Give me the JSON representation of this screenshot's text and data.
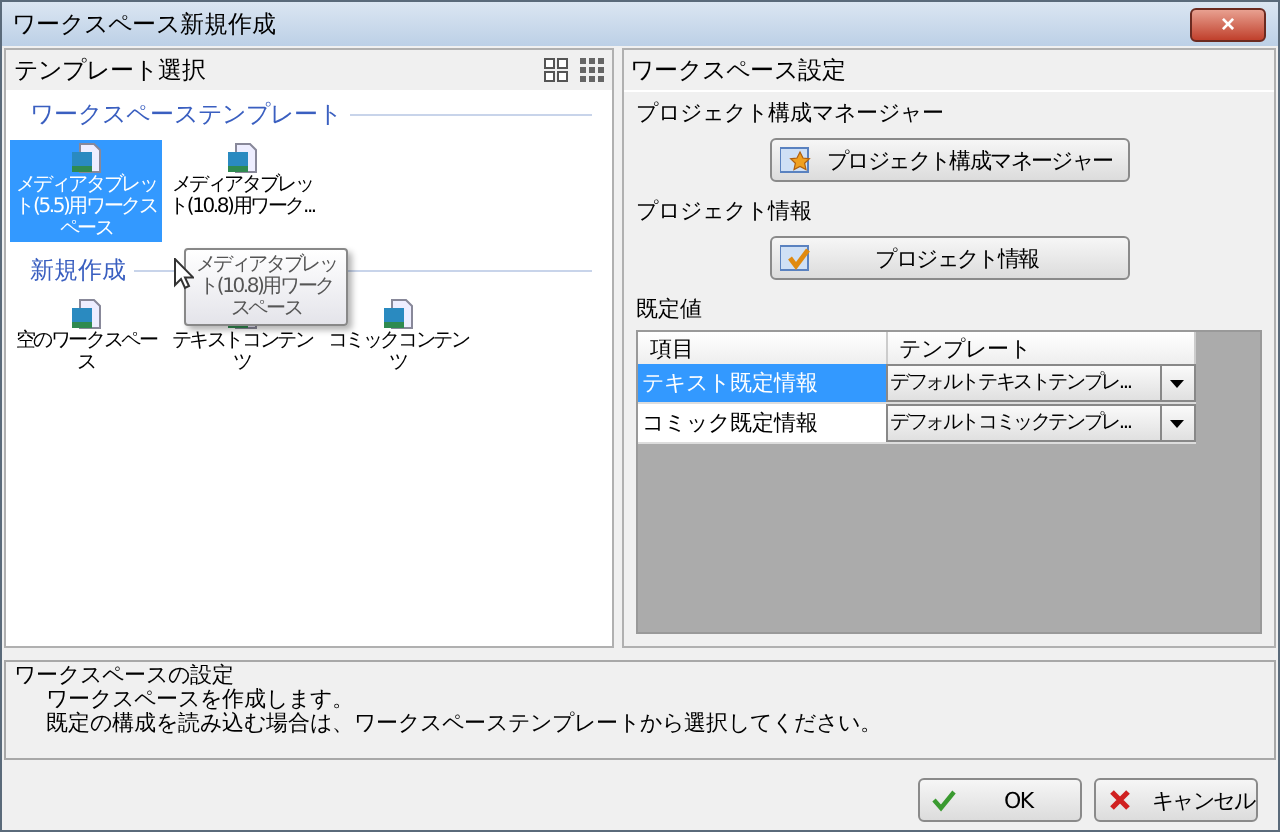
{
  "window": {
    "title": "ワークスペース新規作成",
    "close": "×"
  },
  "template_panel": {
    "title": "テンプレート選択",
    "sections": [
      {
        "title": "ワークスペーステンプレート",
        "items": [
          {
            "label": "メディアタブレット(5.5)用ワークスペース",
            "selected": true
          },
          {
            "label": "メディアタブレット(10.8)用ワーク...",
            "selected": false
          }
        ]
      },
      {
        "title": "新規作成",
        "items": [
          {
            "label": "空のワークスペース",
            "selected": false
          },
          {
            "label": "テキストコンテンツ",
            "selected": false
          },
          {
            "label": "コミックコンテンツ",
            "selected": false
          }
        ]
      }
    ],
    "tooltip": "メディアタブレット(10.8)用ワークスペース"
  },
  "settings_panel": {
    "title": "ワークスペース設定",
    "groups": [
      {
        "label": "プロジェクト構成マネージャー",
        "button": "プロジェクト構成マネージャー",
        "kind": "star"
      },
      {
        "label": "プロジェクト情報",
        "button": "プロジェクト情報",
        "kind": "check"
      }
    ],
    "defaults": {
      "label": "既定値",
      "columns": [
        "項目",
        "テンプレート"
      ],
      "rows": [
        {
          "item": "テキスト既定情報",
          "template": "デフォルトテキストテンプレ...",
          "selected": true
        },
        {
          "item": "コミック既定情報",
          "template": "デフォルトコミックテンプレ...",
          "selected": false
        }
      ]
    }
  },
  "description": {
    "title": "ワークスペースの設定",
    "lines": [
      "ワークスペースを作成します。",
      "既定の構成を読み込む場合は、ワークスペーステンプレートから選択してください。"
    ]
  },
  "buttons": [
    {
      "label": "OK",
      "kind": "ok"
    },
    {
      "label": "キャンセル",
      "kind": "cancel"
    }
  ]
}
